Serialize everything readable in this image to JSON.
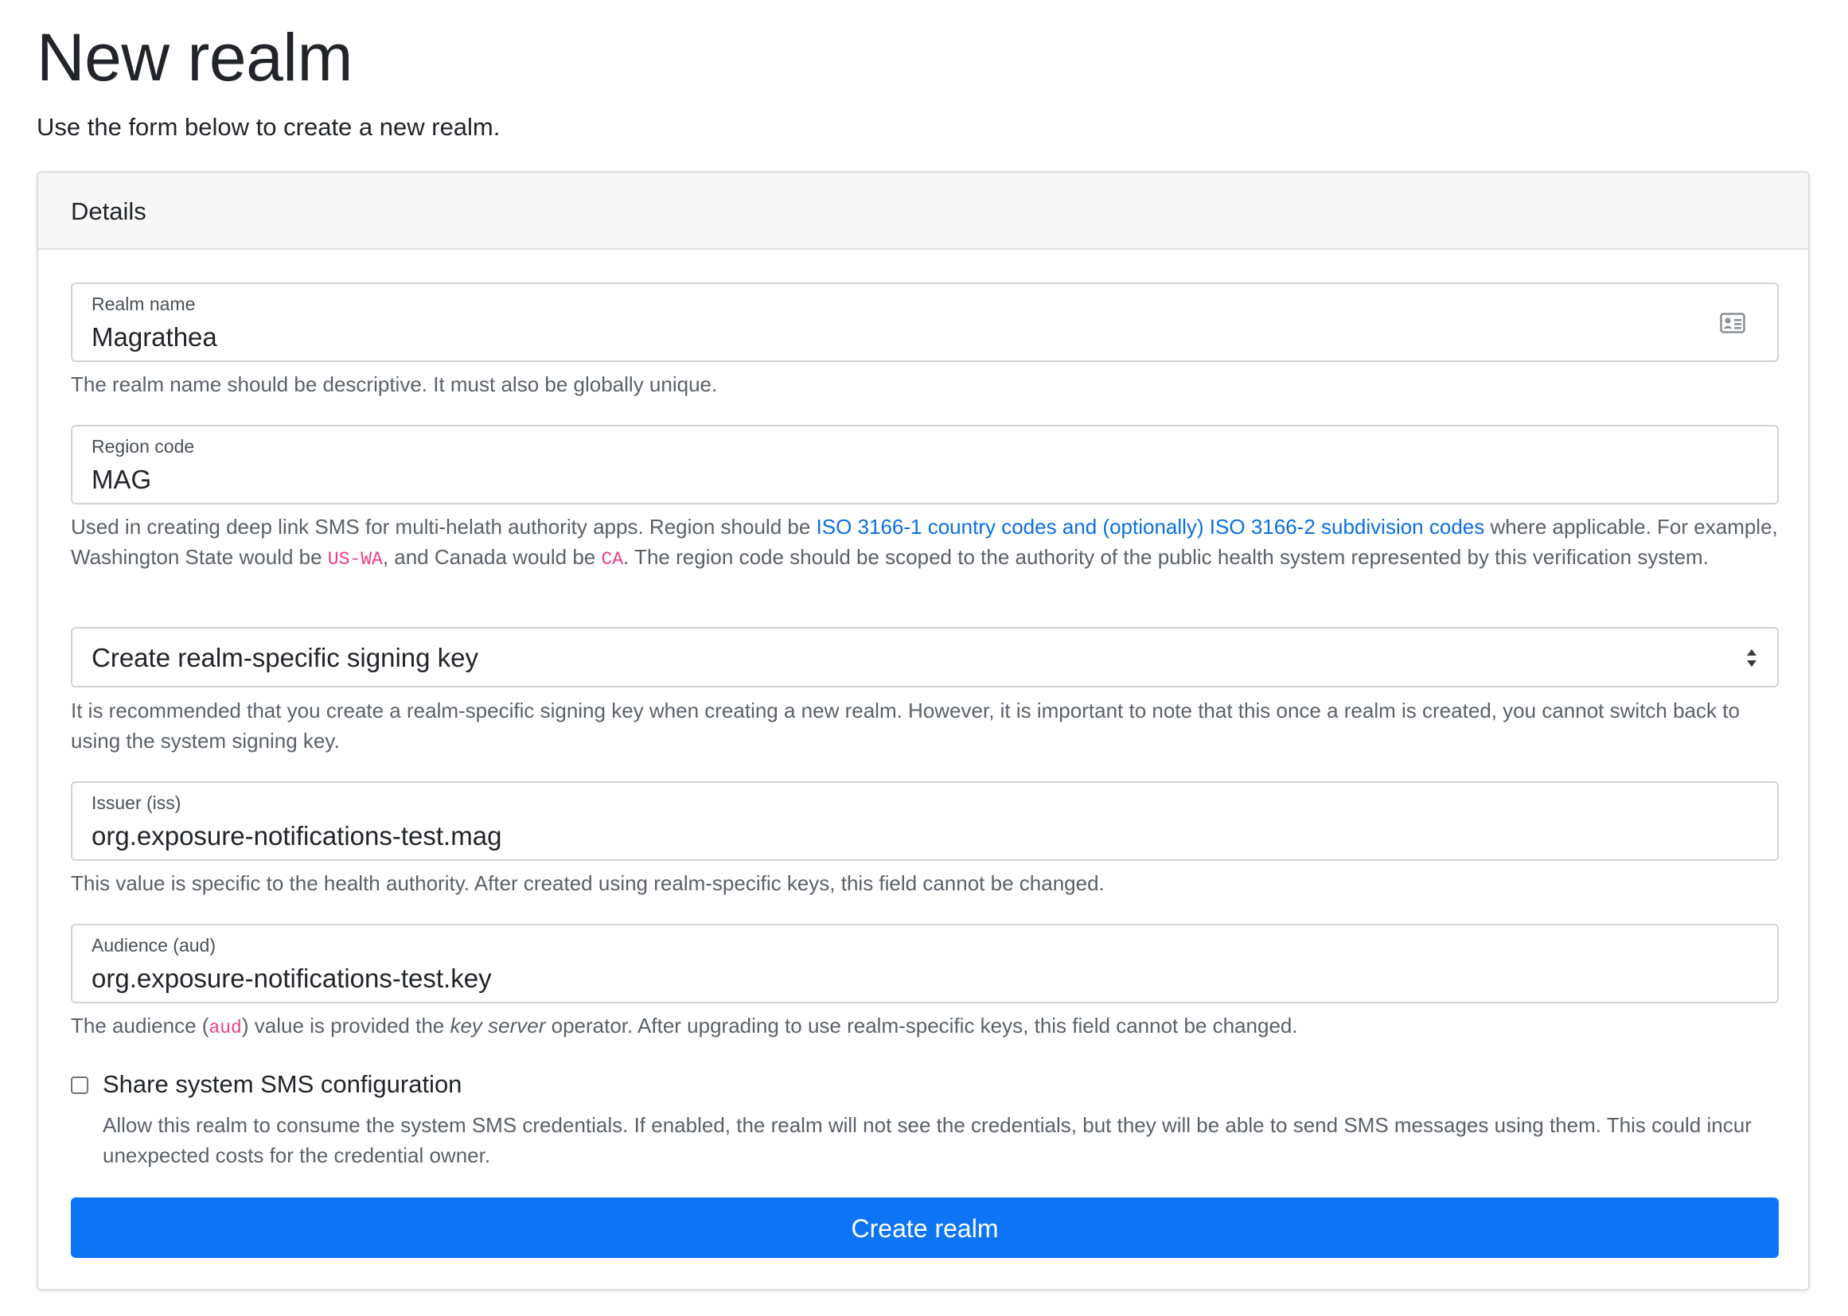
{
  "header": {
    "title": "New realm",
    "lead": "Use the form below to create a new realm."
  },
  "card": {
    "title": "Details"
  },
  "form": {
    "realm_name": {
      "label": "Realm name",
      "value": "Magrathea",
      "icon": "id-card-icon",
      "help": "The realm name should be descriptive. It must also be globally unique."
    },
    "region_code": {
      "label": "Region code",
      "value": "MAG",
      "help_pre": "Used in creating deep link SMS for multi-helath authority apps. Region should be ",
      "help_link": "ISO 3166-1 country codes and (optionally) ISO 3166-2 subdivision codes",
      "help_mid1": " where applicable. For example, Washington State would be ",
      "help_code1": "US-WA",
      "help_mid2": ", and Canada would be ",
      "help_code2": "CA",
      "help_post": ". The region code should be scoped to the authority of the public health system represented by this verification system."
    },
    "signing_key": {
      "selected": "Create realm-specific signing key",
      "help": "It is recommended that you create a realm-specific signing key when creating a new realm. However, it is important to note that this once a realm is created, you cannot switch back to using the system signing key."
    },
    "issuer": {
      "label": "Issuer (iss)",
      "value": "org.exposure-notifications-test.mag",
      "help": "This value is specific to the health authority. After created using realm-specific keys, this field cannot be changed."
    },
    "audience": {
      "label": "Audience (aud)",
      "value": "org.exposure-notifications-test.key",
      "help_pre": "The audience (",
      "help_code": "aud",
      "help_mid": ") value is provided the ",
      "help_em": "key server",
      "help_post": " operator. After upgrading to use realm-specific keys, this field cannot be changed."
    },
    "share_sms": {
      "label": "Share system SMS configuration",
      "checked": false,
      "help": "Allow this realm to consume the system SMS credentials. If enabled, the realm will not see the credentials, but they will be able to send SMS messages using them. This could incur unexpected costs for the credential owner."
    },
    "submit_label": "Create realm"
  },
  "colors": {
    "primary": "#0d75f5",
    "link": "#0b6fe0",
    "code": "#e83e8c",
    "card_header_bg": "#f7f7f7"
  }
}
